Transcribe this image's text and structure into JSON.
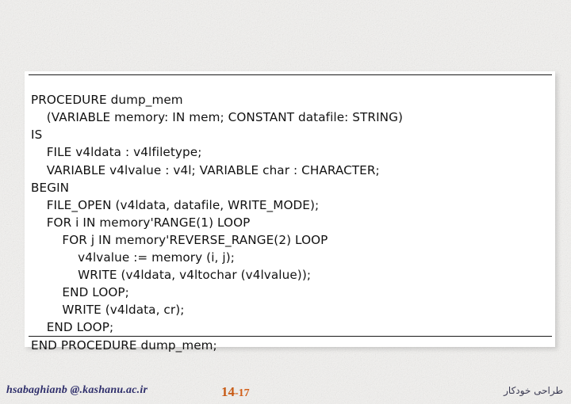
{
  "slide": {
    "background_color": "#f3f2f0",
    "panel_background": "#ffffff",
    "rule_color": "#1a1a1a"
  },
  "code_panel": {
    "language": "VHDL",
    "lines": [
      "PROCEDURE dump_mem",
      "    (VARIABLE memory: IN mem; CONSTANT datafile: STRING)",
      "IS",
      "    FILE v4ldata : v4lfiletype;",
      "    VARIABLE v4lvalue : v4l; VARIABLE char : CHARACTER;",
      "BEGIN",
      "    FILE_OPEN (v4ldata, datafile, WRITE_MODE);",
      "    FOR i IN memory'RANGE(1) LOOP",
      "        FOR j IN memory'REVERSE_RANGE(2) LOOP",
      "            v4lvalue := memory (i, j);",
      "            WRITE (v4ldata, v4ltochar (v4lvalue));",
      "        END LOOP;",
      "        WRITE (v4ldata, cr);",
      "    END LOOP;",
      "END PROCEDURE dump_mem;"
    ],
    "text": "PROCEDURE dump_mem\n    (VARIABLE memory: IN mem; CONSTANT datafile: STRING)\nIS\n    FILE v4ldata : v4lfiletype;\n    VARIABLE v4lvalue : v4l; VARIABLE char : CHARACTER;\nBEGIN\n    FILE_OPEN (v4ldata, datafile, WRITE_MODE);\n    FOR i IN memory'RANGE(1) LOOP\n        FOR j IN memory'REVERSE_RANGE(2) LOOP\n            v4lvalue := memory (i, j);\n            WRITE (v4ldata, v4ltochar (v4lvalue));\n        END LOOP;\n        WRITE (v4ldata, cr);\n    END LOOP;\nEND PROCEDURE dump_mem;"
  },
  "footer": {
    "email": "hsabaghianb @.kashanu.ac.ir",
    "page_major": "14",
    "page_minor": "-17",
    "page_label": "14 -17",
    "subject": "طراحی خودکار",
    "email_color": "#2f2f6b",
    "page_color": "#d2601a"
  }
}
